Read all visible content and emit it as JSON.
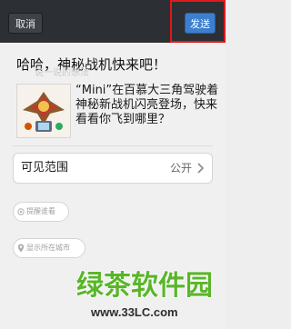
{
  "titlebar": {
    "cancel_label": "取消",
    "send_label": "发送"
  },
  "compose": {
    "text": "哈哈，神秘战机快来吧！",
    "hint": "说一说的想法"
  },
  "shared_item": {
    "text": "“Mini”在百慕大三角驾驶着神秘新战机闪亮登场，快来看看你飞到哪里？",
    "thumbnail_icon": "game-thumbnail"
  },
  "visibility": {
    "label": "可见范围",
    "value": "公开"
  },
  "mention_pill": {
    "label": "提醒谁看"
  },
  "location_pill": {
    "label": "显示所在城市"
  },
  "watermark": {
    "logo_text": "绿茶软件园",
    "url": "www.33LC.com"
  },
  "colors": {
    "titlebar": "#2c2f33",
    "send_button": "#3c7fd0",
    "highlight": "#e0191b",
    "watermark_green": "#5ab52a"
  }
}
